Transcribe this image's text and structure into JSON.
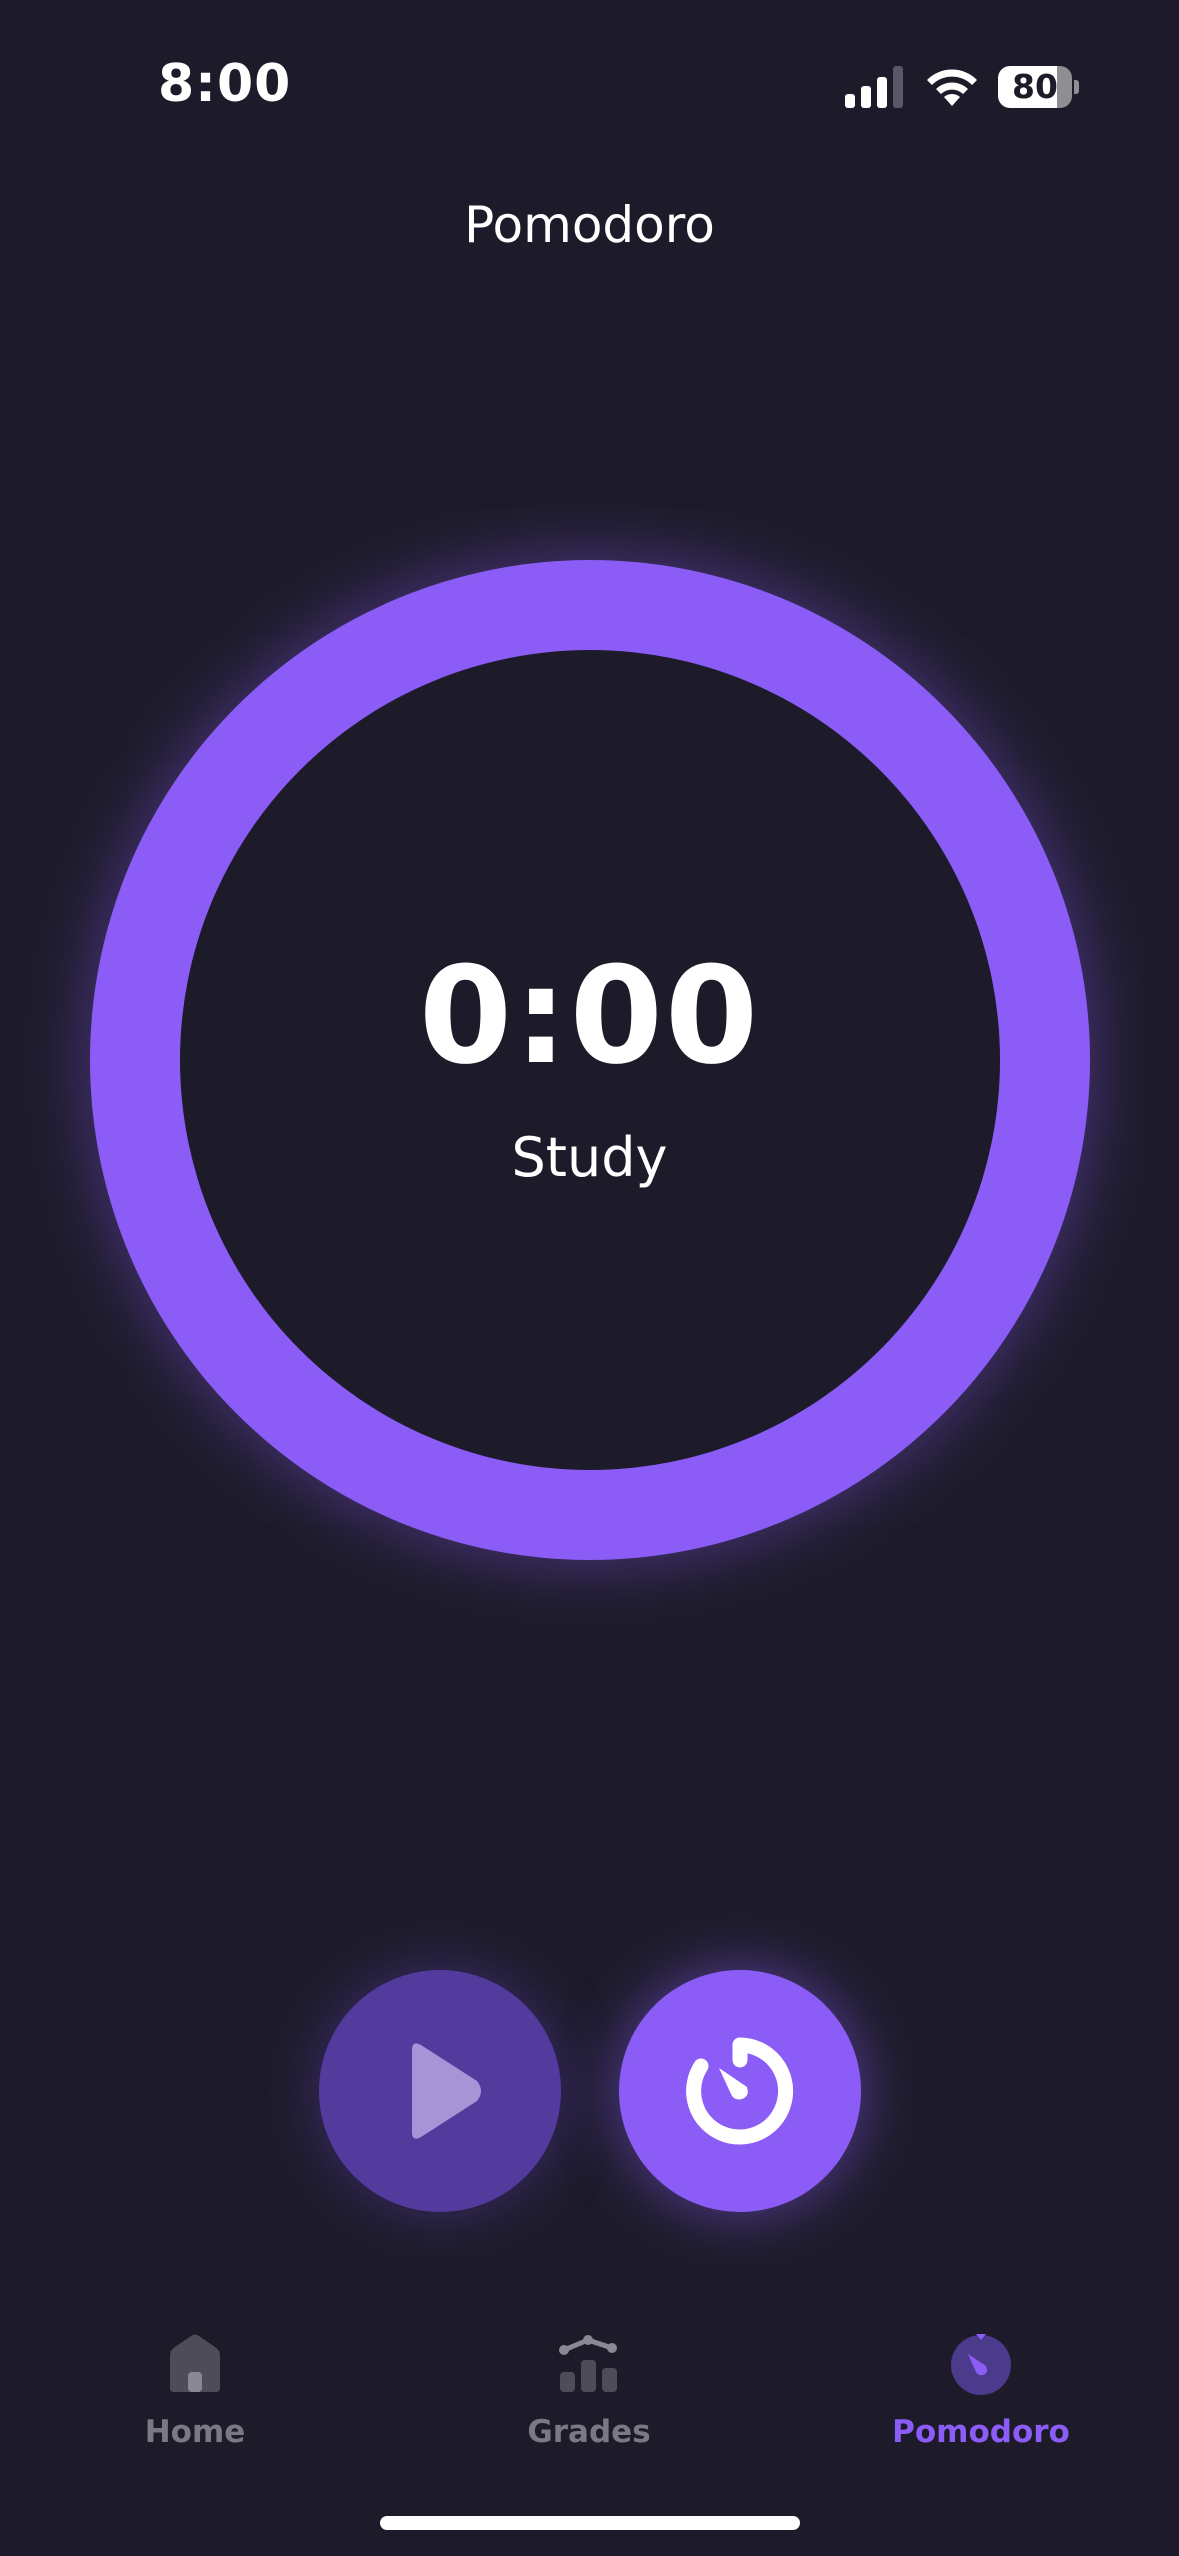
{
  "status_bar": {
    "time": "8:00",
    "battery_level": "80",
    "battery_fraction": 0.8,
    "signal_icon": "cellular-signal-icon",
    "wifi_icon": "wifi-icon"
  },
  "header": {
    "title": "Pomodoro"
  },
  "timer": {
    "time_remaining": "0:00",
    "mode_label": "Study",
    "ring_color": "#8b5cf6"
  },
  "controls": {
    "play_icon": "play-icon",
    "mode_icon": "timer-icon"
  },
  "tab_bar": {
    "items": [
      {
        "label": "Home",
        "icon": "home-icon",
        "active": false
      },
      {
        "label": "Grades",
        "icon": "chart-icon",
        "active": false
      },
      {
        "label": "Pomodoro",
        "icon": "timer-icon",
        "active": true
      }
    ]
  },
  "colors": {
    "background": "#1d1b2a",
    "accent": "#8b5cf6",
    "inactive_tab": "#7a7883"
  }
}
